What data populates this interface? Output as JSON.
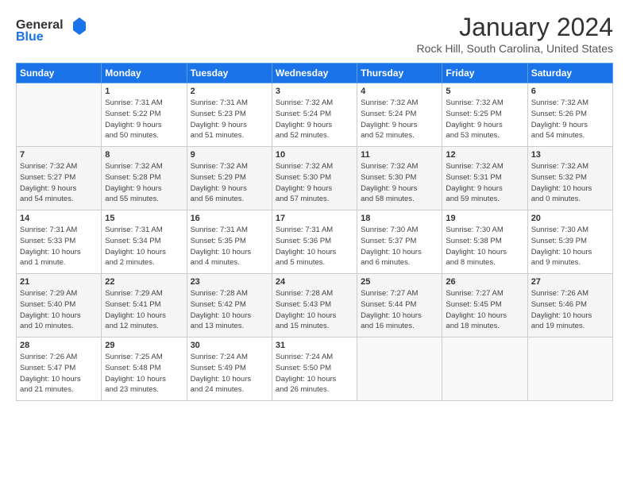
{
  "app": {
    "logo_general": "General",
    "logo_blue": "Blue"
  },
  "header": {
    "title": "January 2024",
    "subtitle": "Rock Hill, South Carolina, United States"
  },
  "weekdays": [
    "Sunday",
    "Monday",
    "Tuesday",
    "Wednesday",
    "Thursday",
    "Friday",
    "Saturday"
  ],
  "weeks": [
    [
      {
        "day": "",
        "info": ""
      },
      {
        "day": "1",
        "info": "Sunrise: 7:31 AM\nSunset: 5:22 PM\nDaylight: 9 hours\nand 50 minutes."
      },
      {
        "day": "2",
        "info": "Sunrise: 7:31 AM\nSunset: 5:23 PM\nDaylight: 9 hours\nand 51 minutes."
      },
      {
        "day": "3",
        "info": "Sunrise: 7:32 AM\nSunset: 5:24 PM\nDaylight: 9 hours\nand 52 minutes."
      },
      {
        "day": "4",
        "info": "Sunrise: 7:32 AM\nSunset: 5:24 PM\nDaylight: 9 hours\nand 52 minutes."
      },
      {
        "day": "5",
        "info": "Sunrise: 7:32 AM\nSunset: 5:25 PM\nDaylight: 9 hours\nand 53 minutes."
      },
      {
        "day": "6",
        "info": "Sunrise: 7:32 AM\nSunset: 5:26 PM\nDaylight: 9 hours\nand 54 minutes."
      }
    ],
    [
      {
        "day": "7",
        "info": "Sunrise: 7:32 AM\nSunset: 5:27 PM\nDaylight: 9 hours\nand 54 minutes."
      },
      {
        "day": "8",
        "info": "Sunrise: 7:32 AM\nSunset: 5:28 PM\nDaylight: 9 hours\nand 55 minutes."
      },
      {
        "day": "9",
        "info": "Sunrise: 7:32 AM\nSunset: 5:29 PM\nDaylight: 9 hours\nand 56 minutes."
      },
      {
        "day": "10",
        "info": "Sunrise: 7:32 AM\nSunset: 5:30 PM\nDaylight: 9 hours\nand 57 minutes."
      },
      {
        "day": "11",
        "info": "Sunrise: 7:32 AM\nSunset: 5:30 PM\nDaylight: 9 hours\nand 58 minutes."
      },
      {
        "day": "12",
        "info": "Sunrise: 7:32 AM\nSunset: 5:31 PM\nDaylight: 9 hours\nand 59 minutes."
      },
      {
        "day": "13",
        "info": "Sunrise: 7:32 AM\nSunset: 5:32 PM\nDaylight: 10 hours\nand 0 minutes."
      }
    ],
    [
      {
        "day": "14",
        "info": "Sunrise: 7:31 AM\nSunset: 5:33 PM\nDaylight: 10 hours\nand 1 minute."
      },
      {
        "day": "15",
        "info": "Sunrise: 7:31 AM\nSunset: 5:34 PM\nDaylight: 10 hours\nand 2 minutes."
      },
      {
        "day": "16",
        "info": "Sunrise: 7:31 AM\nSunset: 5:35 PM\nDaylight: 10 hours\nand 4 minutes."
      },
      {
        "day": "17",
        "info": "Sunrise: 7:31 AM\nSunset: 5:36 PM\nDaylight: 10 hours\nand 5 minutes."
      },
      {
        "day": "18",
        "info": "Sunrise: 7:30 AM\nSunset: 5:37 PM\nDaylight: 10 hours\nand 6 minutes."
      },
      {
        "day": "19",
        "info": "Sunrise: 7:30 AM\nSunset: 5:38 PM\nDaylight: 10 hours\nand 8 minutes."
      },
      {
        "day": "20",
        "info": "Sunrise: 7:30 AM\nSunset: 5:39 PM\nDaylight: 10 hours\nand 9 minutes."
      }
    ],
    [
      {
        "day": "21",
        "info": "Sunrise: 7:29 AM\nSunset: 5:40 PM\nDaylight: 10 hours\nand 10 minutes."
      },
      {
        "day": "22",
        "info": "Sunrise: 7:29 AM\nSunset: 5:41 PM\nDaylight: 10 hours\nand 12 minutes."
      },
      {
        "day": "23",
        "info": "Sunrise: 7:28 AM\nSunset: 5:42 PM\nDaylight: 10 hours\nand 13 minutes."
      },
      {
        "day": "24",
        "info": "Sunrise: 7:28 AM\nSunset: 5:43 PM\nDaylight: 10 hours\nand 15 minutes."
      },
      {
        "day": "25",
        "info": "Sunrise: 7:27 AM\nSunset: 5:44 PM\nDaylight: 10 hours\nand 16 minutes."
      },
      {
        "day": "26",
        "info": "Sunrise: 7:27 AM\nSunset: 5:45 PM\nDaylight: 10 hours\nand 18 minutes."
      },
      {
        "day": "27",
        "info": "Sunrise: 7:26 AM\nSunset: 5:46 PM\nDaylight: 10 hours\nand 19 minutes."
      }
    ],
    [
      {
        "day": "28",
        "info": "Sunrise: 7:26 AM\nSunset: 5:47 PM\nDaylight: 10 hours\nand 21 minutes."
      },
      {
        "day": "29",
        "info": "Sunrise: 7:25 AM\nSunset: 5:48 PM\nDaylight: 10 hours\nand 23 minutes."
      },
      {
        "day": "30",
        "info": "Sunrise: 7:24 AM\nSunset: 5:49 PM\nDaylight: 10 hours\nand 24 minutes."
      },
      {
        "day": "31",
        "info": "Sunrise: 7:24 AM\nSunset: 5:50 PM\nDaylight: 10 hours\nand 26 minutes."
      },
      {
        "day": "",
        "info": ""
      },
      {
        "day": "",
        "info": ""
      },
      {
        "day": "",
        "info": ""
      }
    ]
  ]
}
